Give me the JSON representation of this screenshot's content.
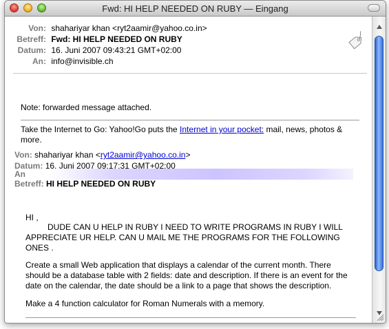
{
  "window": {
    "title": "Fwd: HI HELP NEEDED ON RUBY — Eingang"
  },
  "header": [
    {
      "label": "Von:",
      "value": "shahariyar khan <ryt2aamir@yahoo.co.in>"
    },
    {
      "label": "Betreff:",
      "value": "Fwd: HI HELP NEEDED ON RUBY"
    },
    {
      "label": "Datum:",
      "value": "16. Juni 2007 09:43:21 GMT+02:00"
    },
    {
      "label": "An:",
      "value": "info@invisible.ch"
    }
  ],
  "body": {
    "note": "Note: forwarded message attached.",
    "ad_prefix": "Take the Internet to Go: Yahoo!Go puts the ",
    "ad_link": "Internet in your pocket:",
    "ad_suffix": " mail, news, photos &",
    "ad_line2": "more."
  },
  "forwarded": {
    "von_label": "Von:",
    "von_name": "shahariyar khan <",
    "von_email": "ryt2aamir@yahoo.co.in",
    "von_close": ">",
    "datum_label": "Datum:",
    "datum_value": "16. Juni 2007 09:17:31 GMT+02:00",
    "an_label": "An",
    "betreff_label": "Betreff:",
    "betreff_value": "HI HELP NEEDED ON RUBY"
  },
  "message": {
    "greeting": "HI ,",
    "line1": "DUDE CAN U HELP IN RUBY I NEED TO WRITE PROGRAMS IN RUBY I WILL",
    "line2": "APPRECIATE UR HELP. CAN U MAIL ME THE PROGRAMS FOR THE FOLLOWING",
    "line3": "ONES .",
    "p1_line1": "Create a small Web application that displays a calendar of the current month. There",
    "p1_line2": "should be a database table with 2 fields: date and description. If there is an event for the",
    "p1_line3": "date on the calendar, the date should be a link to a page that shows the description.",
    "p2": "Make a 4 function calculator for Roman Numerals with a memory."
  }
}
